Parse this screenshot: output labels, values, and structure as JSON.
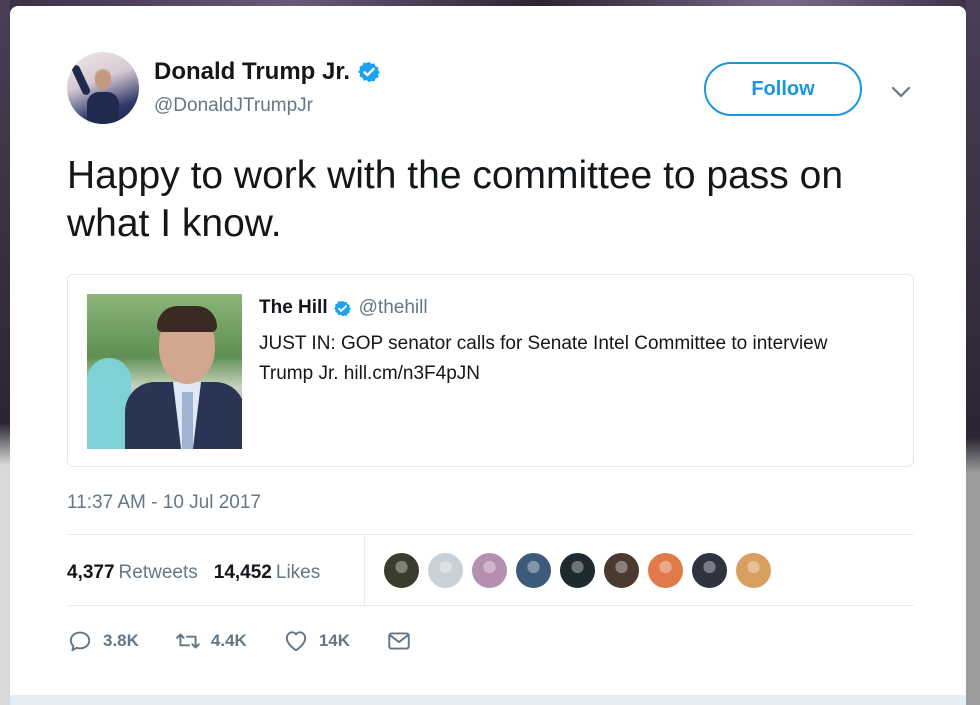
{
  "tweet": {
    "author": {
      "display_name": "Donald Trump Jr.",
      "handle": "@DonaldJTrumpJr",
      "verified": true,
      "avatar_icon": "profile-photo"
    },
    "follow_label": "Follow",
    "menu_icon": "chevron-down-icon",
    "text": "Happy to work with the committee to pass on what I know.",
    "quoted": {
      "name": "The Hill",
      "handle": "@thehill",
      "verified": true,
      "text": "JUST IN: GOP senator calls for Senate Intel Committee to interview Trump Jr. hill.cm/n3F4pJN",
      "image_icon": "quoted-tweet-photo"
    },
    "timestamp": "11:37 AM - 10 Jul 2017",
    "stats": {
      "retweets_count": "4,377",
      "retweets_label": "Retweets",
      "likes_count": "14,452",
      "likes_label": "Likes"
    },
    "likers": [
      {
        "color": "#3b3b2e"
      },
      {
        "color": "#c9d1d8"
      },
      {
        "color": "#b58fb1"
      },
      {
        "color": "#3d5a7a"
      },
      {
        "color": "#1f2a2e"
      },
      {
        "color": "#4a3a30"
      },
      {
        "color": "#e07a4a"
      },
      {
        "color": "#2f3340"
      },
      {
        "color": "#d8a060"
      }
    ],
    "actions": {
      "reply_count": "3.8K",
      "retweet_count": "4.4K",
      "like_count": "14K"
    },
    "colors": {
      "accent": "#1b95e0",
      "verified": "#1da1f2",
      "text": "#14171a",
      "muted": "#657786"
    }
  }
}
